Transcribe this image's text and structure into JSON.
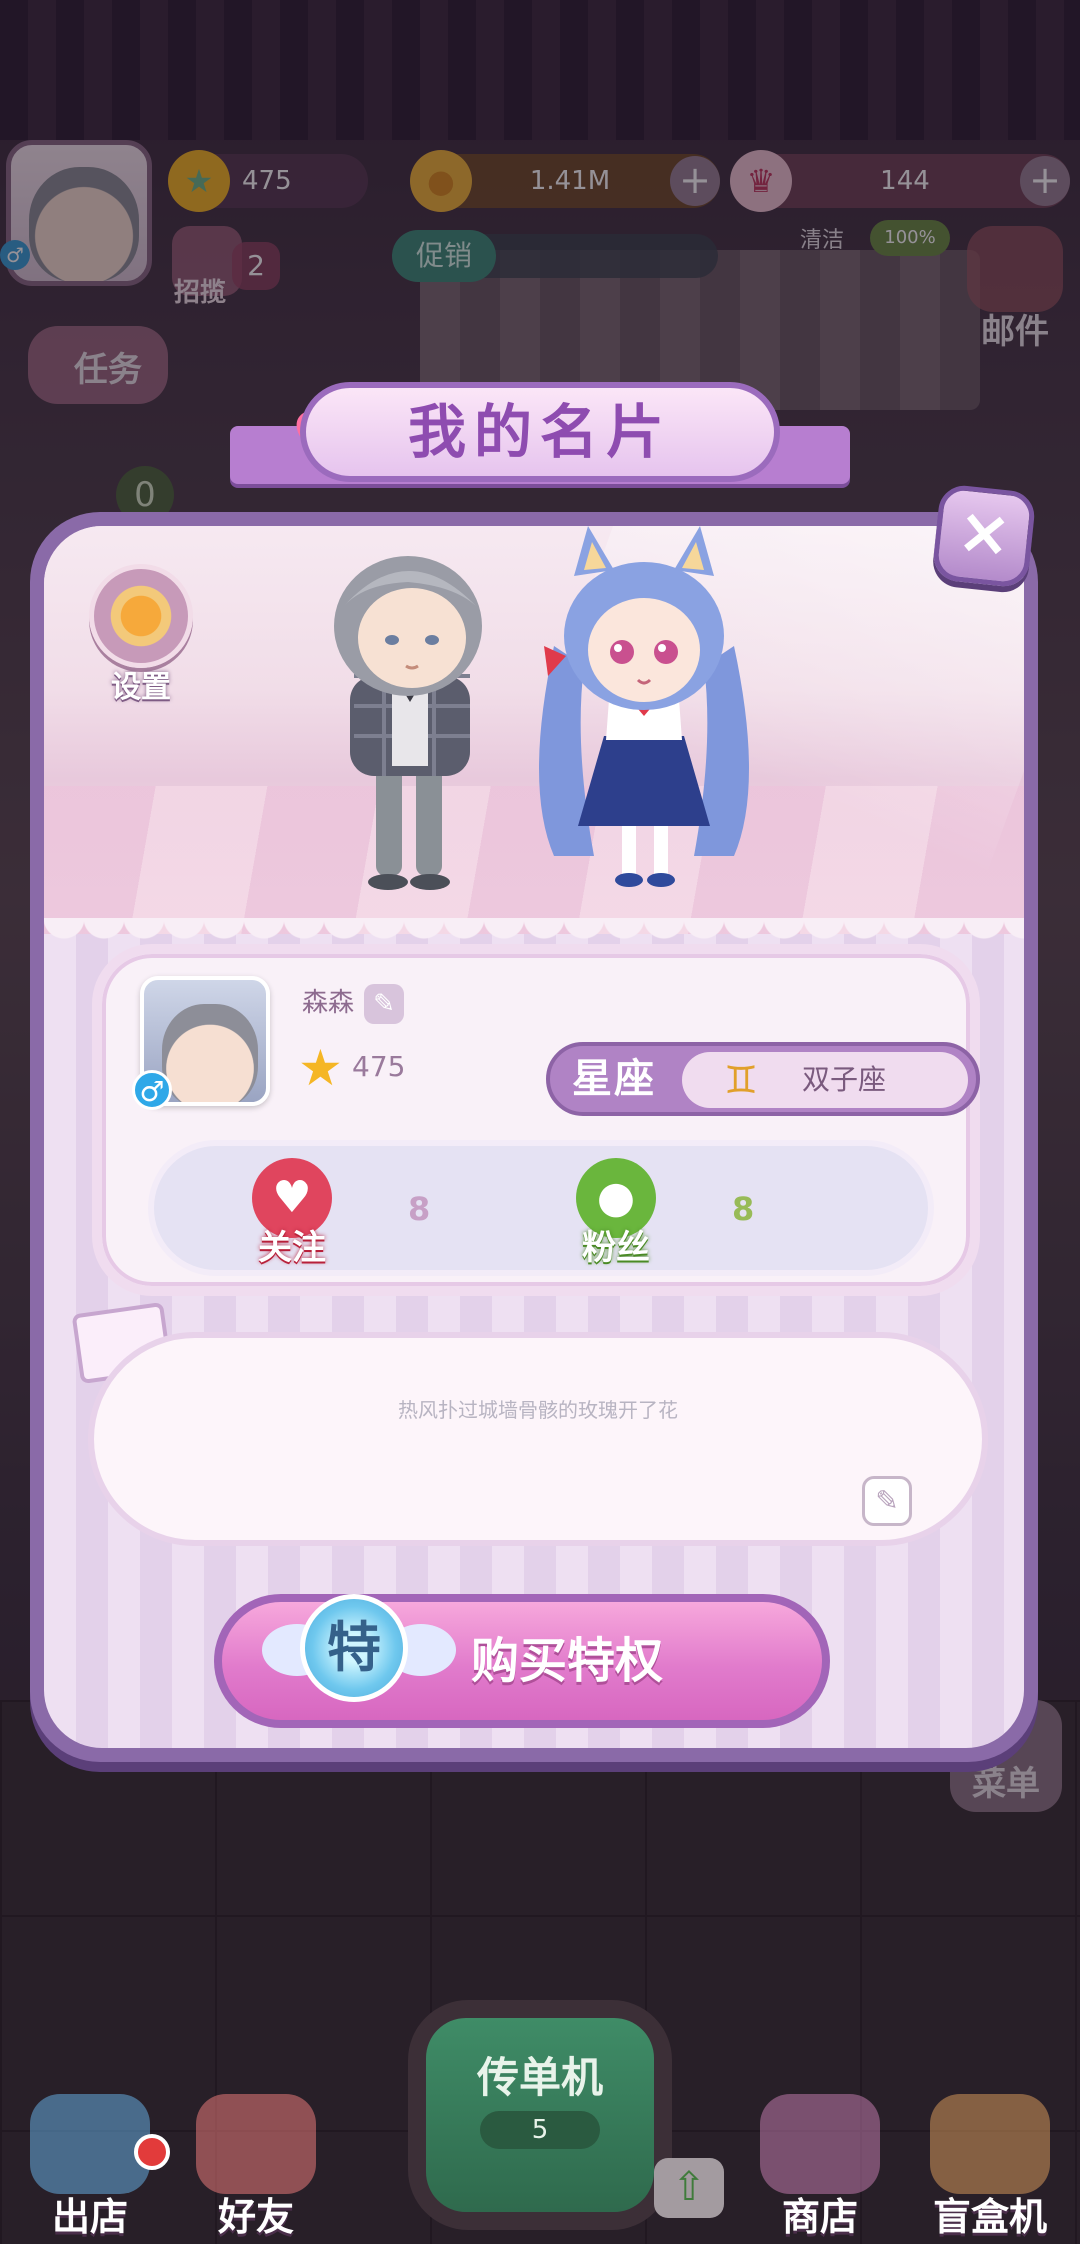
{
  "hud": {
    "stars": "475",
    "coins": "1.41M",
    "gems": "144",
    "recruit_label": "招揽",
    "recruit_count": "2",
    "promo_label": "促销",
    "clean_label": "清洁",
    "clean_value": "100%",
    "task_label": "任务",
    "task_count": "0",
    "mail_label": "邮件",
    "menu_label": "菜单"
  },
  "modal": {
    "title": "我的名片",
    "close_icon": "x-icon",
    "settings_label": "设置",
    "profile": {
      "name": "森森",
      "gender": "♂",
      "level": "475",
      "zodiac_label": "星座",
      "zodiac_symbol": "♊",
      "zodiac_value": "双子座",
      "follow_label": "关注",
      "follow_count": "8",
      "fans_label": "粉丝",
      "fans_count": "8"
    },
    "bio_text": "热风扑过城墙骨骸的玫瑰开了花",
    "buy_badge": "特",
    "buy_label": "购买特权"
  },
  "bottom_nav": {
    "out_label": "出店",
    "friends_label": "好友",
    "flyer_label": "传单机",
    "flyer_count": "5",
    "shop_label": "商店",
    "blindbox_label": "盲盒机"
  },
  "colors": {
    "accent_purple": "#8a6aa8",
    "button_pink": "#e17bcc",
    "follow_red": "#e0455e",
    "fans_green": "#6ab63d"
  }
}
